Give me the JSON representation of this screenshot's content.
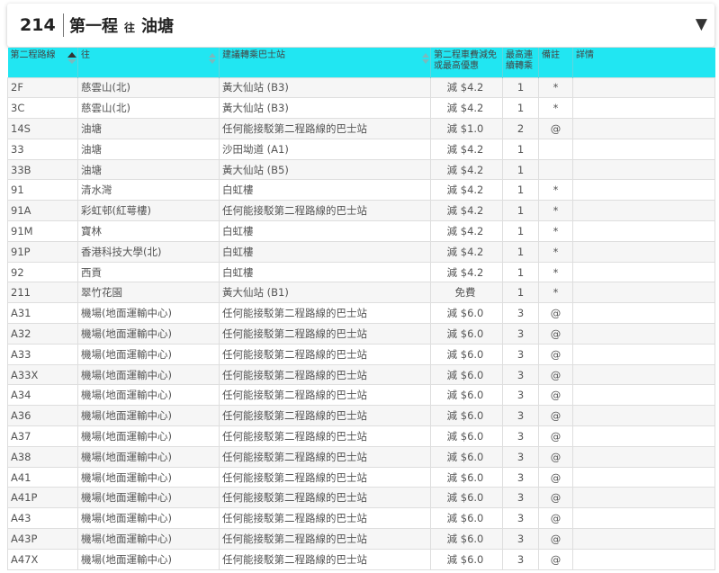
{
  "header": {
    "route_no": "214",
    "title": "第一程",
    "to": "往",
    "destination": "油塘",
    "dropdown_icon": "caret-down-icon"
  },
  "table": {
    "columns": [
      "第二程路線",
      "往",
      "建議轉乘巴士站",
      "第二程車費減免或最高優惠",
      "最高連續轉乘",
      "備註",
      "詳情"
    ],
    "header_color": "#21e6f2",
    "rows": [
      {
        "route": "2F",
        "to": "慈雲山(北)",
        "stop": "黃大仙站 (B3)",
        "discount": "減 $4.2",
        "max": "1",
        "note": "*",
        "detail": ""
      },
      {
        "route": "3C",
        "to": "慈雲山(北)",
        "stop": "黃大仙站 (B3)",
        "discount": "減 $4.2",
        "max": "1",
        "note": "*",
        "detail": ""
      },
      {
        "route": "14S",
        "to": "油塘",
        "stop": "任何能接駁第二程路線的巴士站",
        "discount": "減 $1.0",
        "max": "2",
        "note": "@",
        "detail": ""
      },
      {
        "route": "33",
        "to": "油塘",
        "stop": "沙田坳道 (A1)",
        "discount": "減 $4.2",
        "max": "1",
        "note": "",
        "detail": ""
      },
      {
        "route": "33B",
        "to": "油塘",
        "stop": "黃大仙站 (B5)",
        "discount": "減 $4.2",
        "max": "1",
        "note": "",
        "detail": ""
      },
      {
        "route": "91",
        "to": "清水灣",
        "stop": "白虹樓",
        "discount": "減 $4.2",
        "max": "1",
        "note": "*",
        "detail": ""
      },
      {
        "route": "91A",
        "to": "彩虹邨(紅萼樓)",
        "stop": "任何能接駁第二程路線的巴士站",
        "discount": "減 $4.2",
        "max": "1",
        "note": "*",
        "detail": ""
      },
      {
        "route": "91M",
        "to": "寶林",
        "stop": "白虹樓",
        "discount": "減 $4.2",
        "max": "1",
        "note": "*",
        "detail": ""
      },
      {
        "route": "91P",
        "to": "香港科技大學(北)",
        "stop": "白虹樓",
        "discount": "減 $4.2",
        "max": "1",
        "note": "*",
        "detail": ""
      },
      {
        "route": "92",
        "to": "西貢",
        "stop": "白虹樓",
        "discount": "減 $4.2",
        "max": "1",
        "note": "*",
        "detail": ""
      },
      {
        "route": "211",
        "to": "翠竹花園",
        "stop": "黃大仙站 (B1)",
        "discount": "免費",
        "max": "1",
        "note": "*",
        "detail": ""
      },
      {
        "route": "A31",
        "to": "機場(地面運輸中心)",
        "stop": "任何能接駁第二程路線的巴士站",
        "discount": "減 $6.0",
        "max": "3",
        "note": "@",
        "detail": ""
      },
      {
        "route": "A32",
        "to": "機場(地面運輸中心)",
        "stop": "任何能接駁第二程路線的巴士站",
        "discount": "減 $6.0",
        "max": "3",
        "note": "@",
        "detail": ""
      },
      {
        "route": "A33",
        "to": "機場(地面運輸中心)",
        "stop": "任何能接駁第二程路線的巴士站",
        "discount": "減 $6.0",
        "max": "3",
        "note": "@",
        "detail": ""
      },
      {
        "route": "A33X",
        "to": "機場(地面運輸中心)",
        "stop": "任何能接駁第二程路線的巴士站",
        "discount": "減 $6.0",
        "max": "3",
        "note": "@",
        "detail": ""
      },
      {
        "route": "A34",
        "to": "機場(地面運輸中心)",
        "stop": "任何能接駁第二程路線的巴士站",
        "discount": "減 $6.0",
        "max": "3",
        "note": "@",
        "detail": ""
      },
      {
        "route": "A36",
        "to": "機場(地面運輸中心)",
        "stop": "任何能接駁第二程路線的巴士站",
        "discount": "減 $6.0",
        "max": "3",
        "note": "@",
        "detail": ""
      },
      {
        "route": "A37",
        "to": "機場(地面運輸中心)",
        "stop": "任何能接駁第二程路線的巴士站",
        "discount": "減 $6.0",
        "max": "3",
        "note": "@",
        "detail": ""
      },
      {
        "route": "A38",
        "to": "機場(地面運輸中心)",
        "stop": "任何能接駁第二程路線的巴士站",
        "discount": "減 $6.0",
        "max": "3",
        "note": "@",
        "detail": ""
      },
      {
        "route": "A41",
        "to": "機場(地面運輸中心)",
        "stop": "任何能接駁第二程路線的巴士站",
        "discount": "減 $6.0",
        "max": "3",
        "note": "@",
        "detail": ""
      },
      {
        "route": "A41P",
        "to": "機場(地面運輸中心)",
        "stop": "任何能接駁第二程路線的巴士站",
        "discount": "減 $6.0",
        "max": "3",
        "note": "@",
        "detail": ""
      },
      {
        "route": "A43",
        "to": "機場(地面運輸中心)",
        "stop": "任何能接駁第二程路線的巴士站",
        "discount": "減 $6.0",
        "max": "3",
        "note": "@",
        "detail": ""
      },
      {
        "route": "A43P",
        "to": "機場(地面運輸中心)",
        "stop": "任何能接駁第二程路線的巴士站",
        "discount": "減 $6.0",
        "max": "3",
        "note": "@",
        "detail": ""
      },
      {
        "route": "A47X",
        "to": "機場(地面運輸中心)",
        "stop": "任何能接駁第二程路線的巴士站",
        "discount": "減 $6.0",
        "max": "3",
        "note": "@",
        "detail": ""
      }
    ]
  }
}
